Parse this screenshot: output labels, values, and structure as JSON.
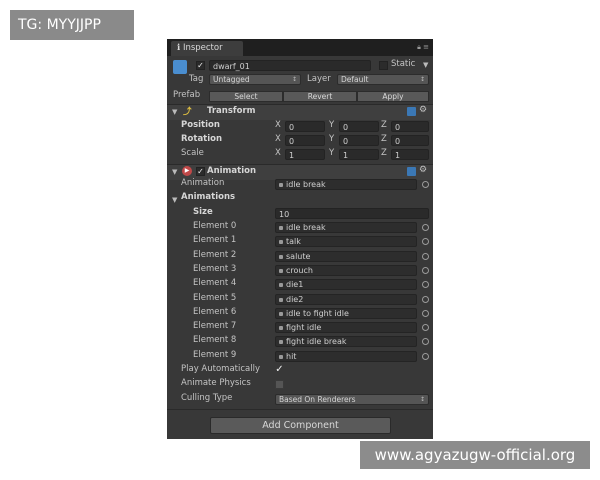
{
  "overlay": {
    "tag_text": "TG: MYYJJPP",
    "watermark_text": "www.agyazugw-official.org"
  },
  "tab": {
    "label": "Inspector"
  },
  "gameobject": {
    "name": "dwarf_01",
    "static_label": "Static",
    "tag_label": "Tag",
    "tag_value": "Untagged",
    "layer_label": "Layer",
    "layer_value": "Default",
    "prefab_label": "Prefab",
    "select_label": "Select",
    "revert_label": "Revert",
    "apply_label": "Apply"
  },
  "transform": {
    "title": "Transform",
    "rows": [
      {
        "label": "Position",
        "x": "0",
        "y": "0",
        "z": "0"
      },
      {
        "label": "Rotation",
        "x": "0",
        "y": "0",
        "z": "0"
      },
      {
        "label": "Scale",
        "x": "1",
        "y": "1",
        "z": "1"
      }
    ],
    "axis_x": "X",
    "axis_y": "Y",
    "axis_z": "Z"
  },
  "animation": {
    "title": "Animation",
    "animation_label": "Animation",
    "animation_value": "idle break",
    "animations_label": "Animations",
    "size_label": "Size",
    "size_value": "10",
    "elements": [
      {
        "label": "Element 0",
        "value": "idle break"
      },
      {
        "label": "Element 1",
        "value": "talk"
      },
      {
        "label": "Element 2",
        "value": "salute"
      },
      {
        "label": "Element 3",
        "value": "crouch"
      },
      {
        "label": "Element 4",
        "value": "die1"
      },
      {
        "label": "Element 5",
        "value": "die2"
      },
      {
        "label": "Element 6",
        "value": "idle to fight idle"
      },
      {
        "label": "Element 7",
        "value": "fight idle"
      },
      {
        "label": "Element 8",
        "value": "fight idle break"
      },
      {
        "label": "Element 9",
        "value": "hit"
      }
    ],
    "play_auto_label": "Play Automatically",
    "play_auto_checked": true,
    "animate_physics_label": "Animate Physics",
    "animate_physics_checked": false,
    "culling_label": "Culling Type",
    "culling_value": "Based On Renderers"
  },
  "add_component_label": "Add Component"
}
